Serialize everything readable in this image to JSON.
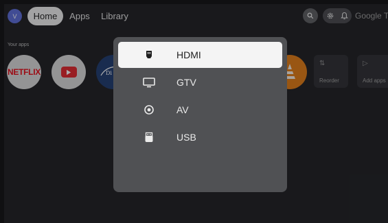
{
  "top_bar": {
    "avatar_letter": "V",
    "nav": [
      "Home",
      "Apps",
      "Library"
    ],
    "active_nav": "Home",
    "brand": "Google TV"
  },
  "apps_section": {
    "label": "Your apps",
    "apps": [
      {
        "name": "netflix",
        "text": "NETFLIX"
      },
      {
        "name": "youtube"
      },
      {
        "name": "disney-plus"
      },
      {
        "name": "hidden-app"
      },
      {
        "name": "vlc"
      }
    ],
    "tiles": [
      {
        "label": "Reorder",
        "icon": "reorder-icon"
      },
      {
        "label": "Add apps",
        "icon": "play-store-icon"
      }
    ]
  },
  "input_dialog": {
    "options": [
      {
        "label": "HDMI",
        "icon": "hdmi-icon",
        "selected": true
      },
      {
        "label": "GTV",
        "icon": "tv-icon",
        "selected": false
      },
      {
        "label": "AV",
        "icon": "av-icon",
        "selected": false
      },
      {
        "label": "USB",
        "icon": "usb-icon",
        "selected": false
      }
    ]
  },
  "colors": {
    "background": "#1c1d20",
    "dialog": "#505154",
    "selected_option": "#f4f4f4",
    "avatar": "#5a6ad8",
    "netflix_red": "#e50914",
    "youtube_red": "#e1242a"
  }
}
